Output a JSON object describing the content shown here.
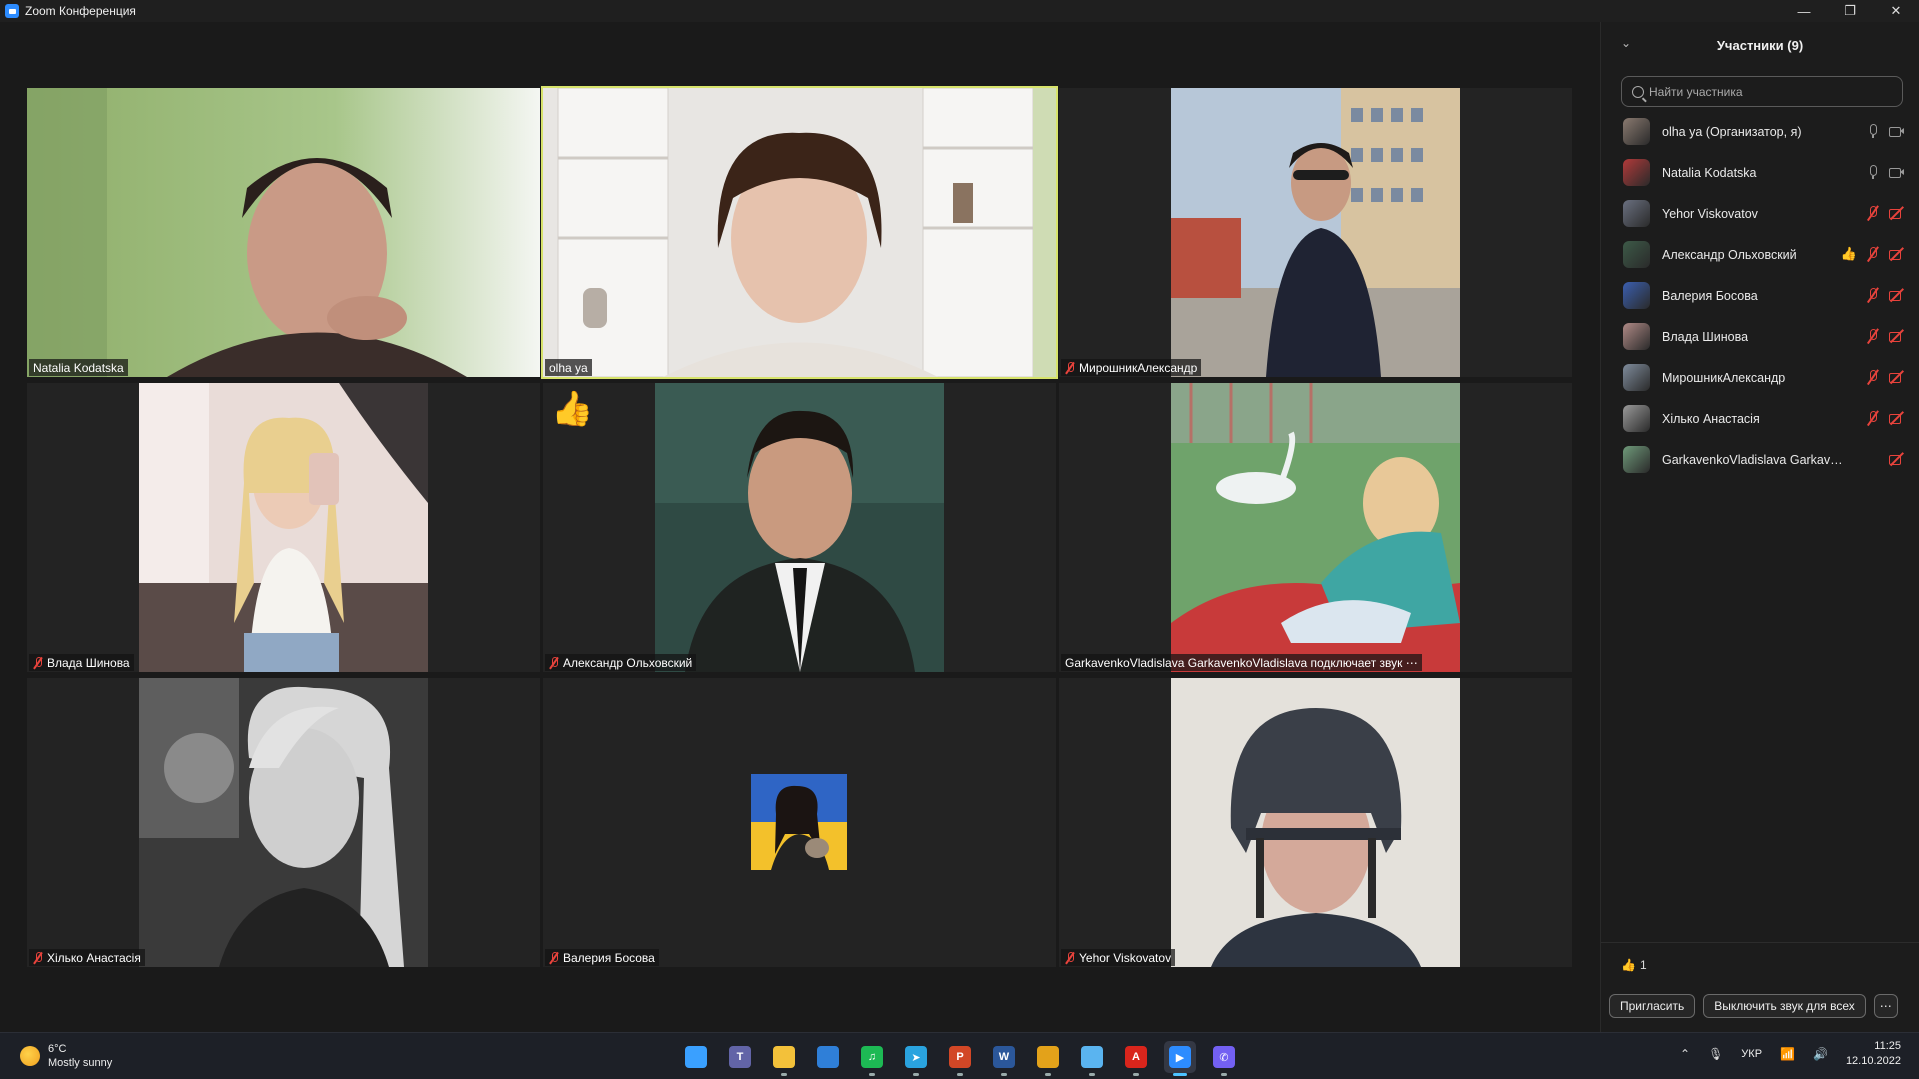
{
  "window": {
    "title": "Zoom Конференция",
    "controls": {
      "minimize": "—",
      "restore": "❐",
      "close": "✕"
    }
  },
  "tiles": [
    {
      "name": "Natalia Kodatska",
      "muted": false,
      "active": false,
      "video": "natalia"
    },
    {
      "name": "olha ya",
      "muted": false,
      "active": true,
      "video": "olha"
    },
    {
      "name": "МирошникАлександр",
      "muted": true,
      "active": false,
      "video": "myroshnyk"
    },
    {
      "name": "Влада Шинова",
      "muted": true,
      "active": false,
      "video": "vlada"
    },
    {
      "name": "Александр Ольховский",
      "muted": true,
      "active": false,
      "video": "olkhovsky",
      "reaction": "👍"
    },
    {
      "name": "GarkavenkoVladislava GarkavenkoVladislava подключает звук ⋯",
      "muted": false,
      "active": false,
      "video": "garkavenko"
    },
    {
      "name": "Хілько  Анастасія",
      "muted": true,
      "active": false,
      "video": "khilko"
    },
    {
      "name": "Валерия Босова",
      "muted": true,
      "active": false,
      "video": "bosova-avatar"
    },
    {
      "name": "Yehor Viskovatov",
      "muted": true,
      "active": false,
      "video": "yehor"
    }
  ],
  "panel": {
    "title": "Участники (9)",
    "collapse_icon": "⌄",
    "search_placeholder": "Найти участника",
    "participants": [
      {
        "name": "olha ya (Организатор, я)",
        "mic": "on",
        "cam": "on",
        "color": "#8a7a70"
      },
      {
        "name": "Natalia Kodatska",
        "mic": "on",
        "cam": "on",
        "color": "#b23a3a"
      },
      {
        "name": "Yehor Viskovatov",
        "mic": "off",
        "cam": "off",
        "color": "#6a7080"
      },
      {
        "name": "Александр Ольховский",
        "mic": "off",
        "cam": "off",
        "color": "#3d5a48",
        "reaction": "👍"
      },
      {
        "name": "Валерия Босова",
        "mic": "off",
        "cam": "off",
        "color": "#3b5fb0"
      },
      {
        "name": "Влада Шинова",
        "mic": "off",
        "cam": "off",
        "color": "#b08a86"
      },
      {
        "name": "МирошникАлександр",
        "mic": "off",
        "cam": "off",
        "color": "#7f8c9c"
      },
      {
        "name": "Хілько  Анастасія",
        "mic": "off",
        "cam": "off",
        "color": "#9a9a9a"
      },
      {
        "name": "GarkavenkoVladislava GarkavenkoVl...",
        "mic": "none",
        "cam": "off",
        "color": "#6f9a7a"
      }
    ],
    "reaction_summary": {
      "emoji": "👍",
      "count": "1"
    },
    "invite_label": "Пригласить",
    "mute_all_label": "Выключить звук для всех",
    "more_label": "⋯"
  },
  "taskbar": {
    "weather_temp": "6°C",
    "weather_desc": "Mostly sunny",
    "apps": [
      {
        "name": "start",
        "label": "",
        "color": "#3aa0ff",
        "running": false,
        "focused": false
      },
      {
        "name": "teams",
        "label": "T",
        "color": "#6264a7",
        "running": false,
        "focused": false
      },
      {
        "name": "file-explorer",
        "label": "",
        "color": "#f3c13a",
        "running": true,
        "focused": false
      },
      {
        "name": "store",
        "label": "",
        "color": "#2f7fd8",
        "running": false,
        "focused": false
      },
      {
        "name": "spotify",
        "label": "♫",
        "color": "#1db954",
        "running": true,
        "focused": false
      },
      {
        "name": "telegram",
        "label": "➤",
        "color": "#2aa3df",
        "running": true,
        "focused": false
      },
      {
        "name": "powerpoint",
        "label": "P",
        "color": "#d24726",
        "running": true,
        "focused": false
      },
      {
        "name": "word",
        "label": "W",
        "color": "#2b579a",
        "running": true,
        "focused": false
      },
      {
        "name": "chrome",
        "label": "",
        "color": "#e3a21a",
        "running": true,
        "focused": false
      },
      {
        "name": "notepad",
        "label": "",
        "color": "#5ab4f0",
        "running": true,
        "focused": false
      },
      {
        "name": "acrobat",
        "label": "A",
        "color": "#d9251c",
        "running": true,
        "focused": false
      },
      {
        "name": "zoom",
        "label": "▶",
        "color": "#2d8cff",
        "running": true,
        "focused": true
      },
      {
        "name": "viber",
        "label": "✆",
        "color": "#7360f2",
        "running": true,
        "focused": false
      }
    ],
    "language": "УКР",
    "time": "11:25",
    "date": "12.10.2022"
  }
}
